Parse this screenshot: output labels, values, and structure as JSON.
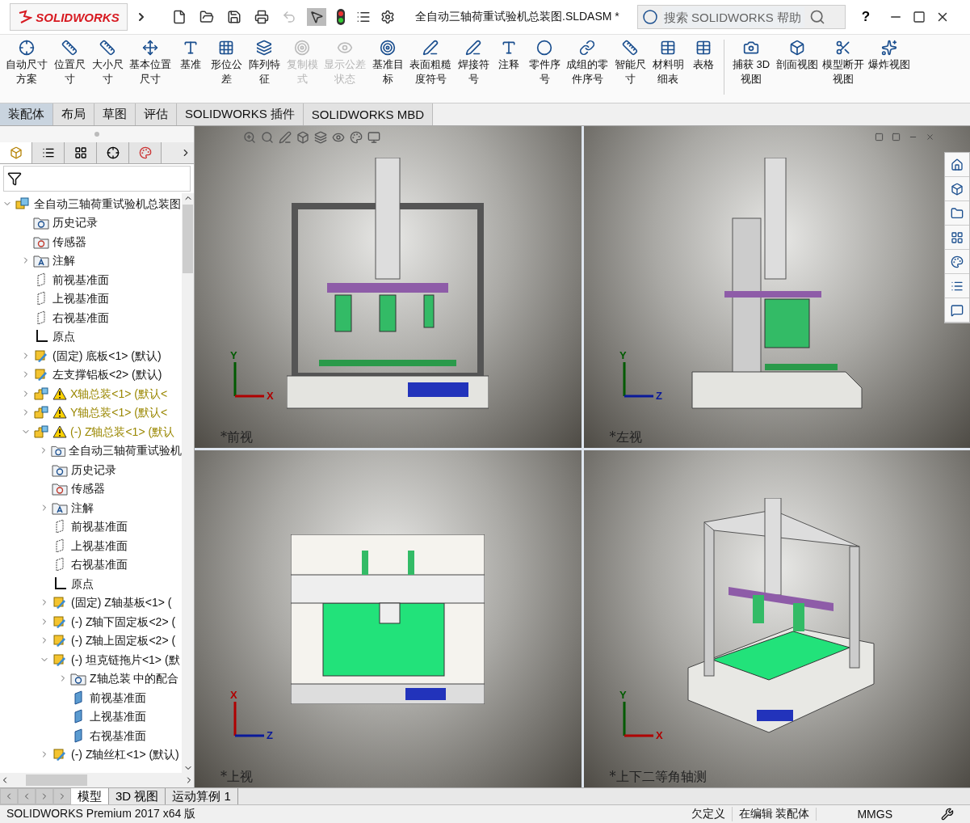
{
  "app": {
    "logo": "SOLIDWORKS",
    "title": "全自动三轴荷重试验机总装图.SLDASM *",
    "search": {
      "placeholder": "搜索 SOLIDWORKS 帮助"
    },
    "help": "?"
  },
  "toolbar": [
    {
      "label": "自动尺寸方案",
      "disabled": false
    },
    {
      "label": "位置尺寸",
      "disabled": false
    },
    {
      "label": "大小尺寸",
      "disabled": false
    },
    {
      "label": "基本位置尺寸",
      "disabled": false
    },
    {
      "label": "基准",
      "disabled": false
    },
    {
      "label": "形位公差",
      "disabled": false
    },
    {
      "label": "阵列特征",
      "disabled": false
    },
    {
      "label": "复制模式",
      "disabled": true
    },
    {
      "label": "显示公差状态",
      "disabled": true
    },
    {
      "label": "基准目标",
      "disabled": false
    },
    {
      "label": "表面粗糙度符号",
      "disabled": false
    },
    {
      "label": "焊接符号",
      "disabled": false
    },
    {
      "label": "注释",
      "disabled": false
    },
    {
      "label": "零件序号",
      "disabled": false
    },
    {
      "label": "成组的零件序号",
      "disabled": false
    },
    {
      "label": "智能尺寸",
      "disabled": false
    },
    {
      "label": "材料明细表",
      "disabled": false
    },
    {
      "label": "表格",
      "disabled": false
    }
  ],
  "toolbar_right": [
    {
      "label": "捕获 3D 视图"
    },
    {
      "label": "剖面视图"
    },
    {
      "label": "模型断开视图"
    },
    {
      "label": "爆炸视图"
    }
  ],
  "command_tabs": [
    {
      "label": "装配体",
      "selected": true
    },
    {
      "label": "布局",
      "selected": false
    },
    {
      "label": "草图",
      "selected": false
    },
    {
      "label": "评估",
      "selected": false
    },
    {
      "label": "SOLIDWORKS 插件",
      "selected": false
    },
    {
      "label": "SOLIDWORKS MBD",
      "selected": false
    }
  ],
  "tree": {
    "label": "全自动三轴荷重试验机总装图",
    "kind": "assembly",
    "expanded": true,
    "children": [
      {
        "label": "历史记录",
        "kind": "history"
      },
      {
        "label": "传感器",
        "kind": "sensor"
      },
      {
        "label": "注解",
        "kind": "annotation",
        "expanded": false
      },
      {
        "label": "前视基准面",
        "kind": "plane"
      },
      {
        "label": "上视基准面",
        "kind": "plane"
      },
      {
        "label": "右视基准面",
        "kind": "plane"
      },
      {
        "label": "原点",
        "kind": "origin"
      },
      {
        "label": "(固定) 底板<1> (默认)",
        "kind": "part",
        "expanded": false
      },
      {
        "label": "左支撑铝板<2> (默认)",
        "kind": "part",
        "expanded": false
      },
      {
        "label": "X轴总装<1> (默认<",
        "kind": "subassembly",
        "warning": true,
        "expanded": false
      },
      {
        "label": "Y轴总装<1> (默认<",
        "kind": "subassembly",
        "warning": true,
        "expanded": false
      },
      {
        "label": "(-) Z轴总装<1> (默认",
        "kind": "subassembly",
        "warning": true,
        "expanded": true,
        "children": [
          {
            "label": "全自动三轴荷重试验机",
            "kind": "mates",
            "expanded": false
          },
          {
            "label": "历史记录",
            "kind": "history"
          },
          {
            "label": "传感器",
            "kind": "sensor"
          },
          {
            "label": "注解",
            "kind": "annotation",
            "expanded": false
          },
          {
            "label": "前视基准面",
            "kind": "plane"
          },
          {
            "label": "上视基准面",
            "kind": "plane"
          },
          {
            "label": "右视基准面",
            "kind": "plane"
          },
          {
            "label": "原点",
            "kind": "origin"
          },
          {
            "label": "(固定) Z轴基板<1> (",
            "kind": "part",
            "expanded": false
          },
          {
            "label": "(-) Z轴下固定板<2> (",
            "kind": "part",
            "expanded": false
          },
          {
            "label": "(-) Z轴上固定板<2> (",
            "kind": "part",
            "expanded": false
          },
          {
            "label": "(-) 坦克链拖片<1> (默",
            "kind": "part",
            "expanded": true,
            "children": [
              {
                "label": "Z轴总装 中的配合",
                "kind": "mates",
                "expanded": false
              },
              {
                "label": "前视基准面",
                "kind": "solidplane"
              },
              {
                "label": "上视基准面",
                "kind": "solidplane"
              },
              {
                "label": "右视基准面",
                "kind": "solidplane"
              }
            ]
          },
          {
            "label": "(-) Z轴丝杠<1> (默认)",
            "kind": "part",
            "expanded": false
          }
        ]
      }
    ]
  },
  "views": [
    {
      "label": "*前视",
      "kind": "front",
      "axes": [
        "Y",
        "X"
      ]
    },
    {
      "label": "*左视",
      "kind": "left",
      "axes": [
        "Y",
        "Z"
      ]
    },
    {
      "label": "*上视",
      "kind": "top",
      "axes": [
        "X",
        "Z"
      ]
    },
    {
      "label": "*上下二等角轴测",
      "kind": "iso",
      "axes": [
        "Y",
        "X"
      ]
    }
  ],
  "bottom_tabs": [
    {
      "label": "模型",
      "selected": true
    },
    {
      "label": "3D 视图",
      "selected": false
    },
    {
      "label": "运动算例 1",
      "selected": false
    }
  ],
  "status_bar": {
    "product": "SOLIDWORKS Premium 2017 x64 版",
    "state": "欠定义",
    "mode": "在编辑 装配体",
    "units": "MMGS"
  }
}
